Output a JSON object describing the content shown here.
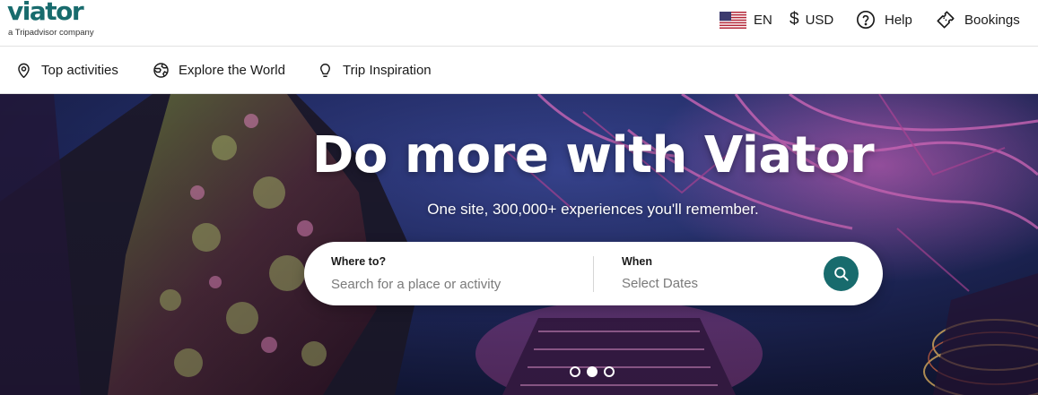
{
  "header": {
    "logo": {
      "word": "viator",
      "sub": "a Tripadvisor company",
      "color": "#186b6d"
    },
    "language": {
      "code": "EN",
      "flag_icon": "us-flag-icon"
    },
    "currency": {
      "symbol": "$",
      "code": "USD"
    },
    "help": {
      "label": "Help",
      "icon": "help-circle-icon"
    },
    "bookings": {
      "label": "Bookings",
      "icon": "ticket-icon"
    }
  },
  "subnav": {
    "items": [
      {
        "label": "Top activities",
        "icon": "map-pin-icon"
      },
      {
        "label": "Explore the World",
        "icon": "globe-icon"
      },
      {
        "label": "Trip Inspiration",
        "icon": "lightbulb-icon"
      }
    ]
  },
  "hero": {
    "title": "Do more with Viator",
    "subtitle": "One site, 300,000+ experiences you'll remember.",
    "search": {
      "where_label": "Where to?",
      "where_placeholder": "Search for a place or activity",
      "when_label": "When",
      "when_placeholder": "Select Dates",
      "button_icon": "search-icon",
      "button_color": "#186b6d"
    },
    "carousel": {
      "slide_count": 3,
      "active_index": 1
    }
  }
}
